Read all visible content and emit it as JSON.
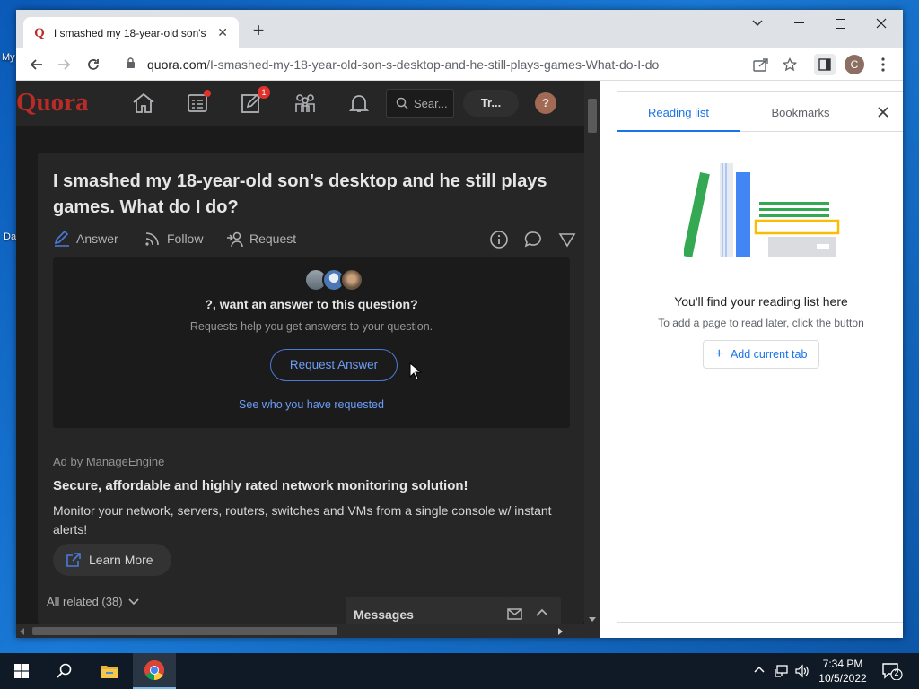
{
  "desktop": {
    "icon_labels": [
      "My",
      "Da"
    ]
  },
  "browser": {
    "tab": {
      "title": "I smashed my 18-year-old son's",
      "favicon": "Q"
    },
    "address_bar": {
      "domain": "quora.com",
      "path": "/I-smashed-my-18-year-old-son-s-desktop-and-he-still-plays-games-What-do-I-do"
    },
    "profile_initial": "C"
  },
  "quora": {
    "logo": "Quora",
    "nav": {
      "notification_badge": "1",
      "search_placeholder": "Sear...",
      "try_button": "Tr...",
      "avatar_initial": "?"
    },
    "question": {
      "title": "I smashed my 18-year-old son’s desktop and he still plays games. What do I do?",
      "actions": {
        "answer": "Answer",
        "follow": "Follow",
        "request": "Request"
      }
    },
    "request_box": {
      "heading": "?, want an answer to this question?",
      "subtext": "Requests help you get answers to your question.",
      "button": "Request Answer",
      "link": "See who you have requested"
    },
    "ad": {
      "by": "Ad by ManageEngine",
      "title": "Secure, affordable and highly rated network monitoring solution!",
      "body": "Monitor your network, servers, routers, switches and VMs from a single console w/ instant alerts!",
      "cta": "Learn More"
    },
    "related": "All related (38)",
    "messages": "Messages"
  },
  "side_panel": {
    "tabs": {
      "reading_list": "Reading list",
      "bookmarks": "Bookmarks"
    },
    "empty_heading": "You'll find your reading list here",
    "empty_subtext": "To add a page to read later, click the button",
    "add_button": "Add current tab"
  },
  "taskbar": {
    "time": "7:34 PM",
    "date": "10/5/2022",
    "notification_count": "2"
  },
  "colors": {
    "quora_red": "#b92b27",
    "link_blue": "#6d9cf6",
    "chrome_blue": "#1a73e8"
  }
}
